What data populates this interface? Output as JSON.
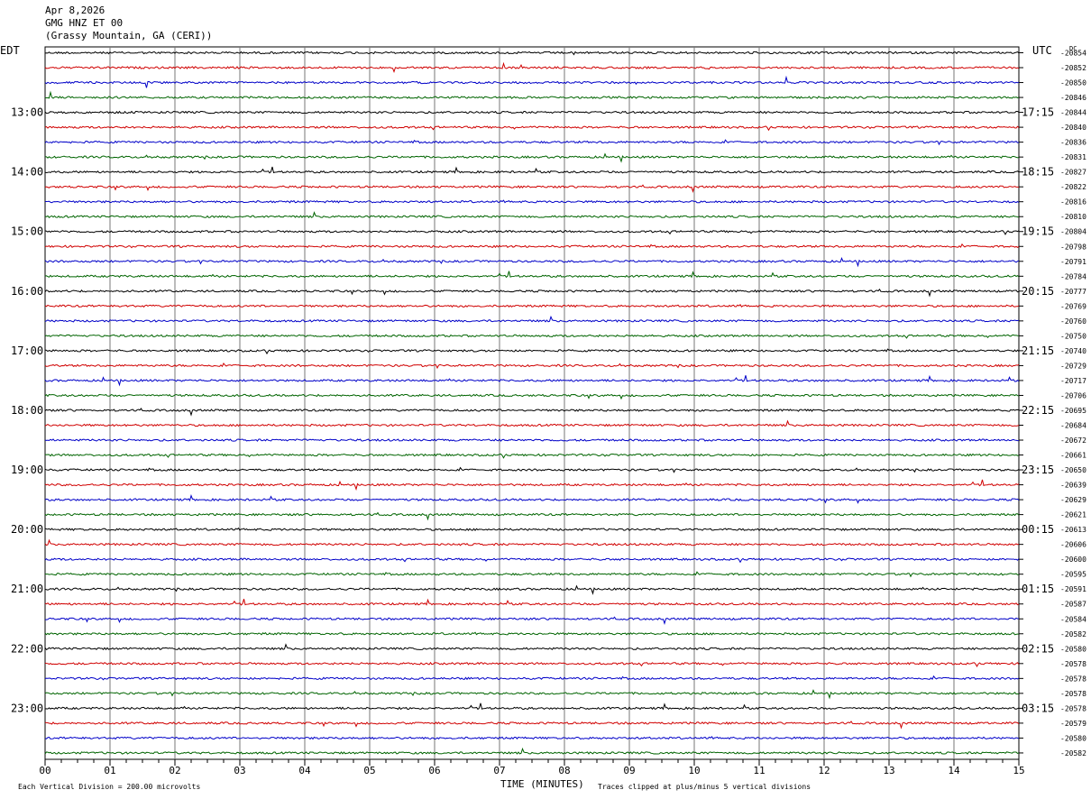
{
  "header": {
    "date": "Apr 8,2026",
    "station": "GMG HNZ ET 00",
    "location": "(Grassy Mountain, GA (CERI))"
  },
  "chart_data": {
    "type": "line",
    "title": "GMG HNZ ET 00",
    "xlabel": "TIME (MINUTES)",
    "left_axis_label": "EDT",
    "right_axis_label": "UTC",
    "dc_label": "DC",
    "xlim": [
      0,
      15
    ],
    "x_ticks": [
      "00",
      "01",
      "02",
      "03",
      "04",
      "05",
      "06",
      "07",
      "08",
      "09",
      "10",
      "11",
      "12",
      "13",
      "14",
      "15"
    ],
    "trace_colors": [
      "#000000",
      "#d00000",
      "#0000c8",
      "#006400"
    ],
    "traces_per_hour": 4,
    "left_time_labels": [
      "13:00",
      "14:00",
      "15:00",
      "16:00",
      "17:00",
      "18:00",
      "19:00",
      "20:00",
      "21:00",
      "22:00",
      "23:00"
    ],
    "right_time_labels": [
      "17:15",
      "18:15",
      "19:15",
      "20:15",
      "21:15",
      "22:15",
      "23:15",
      "00:15",
      "01:15",
      "02:15",
      "03:15"
    ],
    "dc_offsets": [
      "-20854",
      "-20852",
      "-20850",
      "-20846",
      "-20844",
      "-20840",
      "-20836",
      "-20831",
      "-20827",
      "-20822",
      "-20816",
      "-20810",
      "-20804",
      "-20798",
      "-20791",
      "-20784",
      "-20777",
      "-20769",
      "-20760",
      "-20750",
      "-20740",
      "-20729",
      "-20717",
      "-20706",
      "-20695",
      "-20684",
      "-20672",
      "-20661",
      "-20650",
      "-20639",
      "-20629",
      "-20621",
      "-20613",
      "-20606",
      "-20600",
      "-20595",
      "-20591",
      "-20587",
      "-20584",
      "-20582",
      "-20580",
      "-20578",
      "-20578",
      "-20578",
      "-20578",
      "-20579",
      "-20580",
      "-20582"
    ],
    "scale_note": "Each Vertical Division =  200.00 microvolts",
    "clip_note": "Traces clipped at plus/minus 5 vertical divisions",
    "grid": true
  }
}
